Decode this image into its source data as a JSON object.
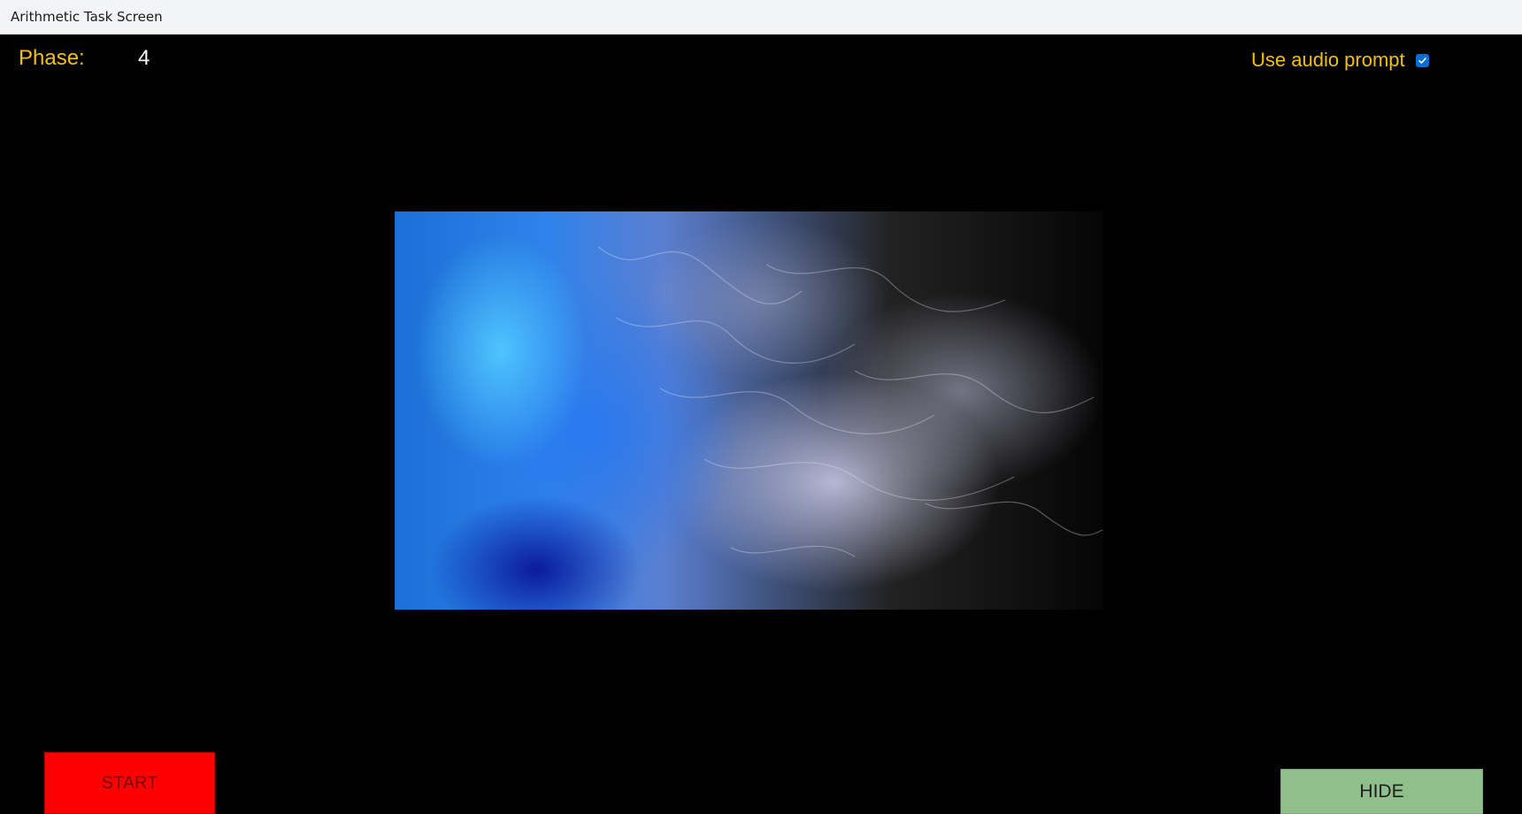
{
  "window": {
    "title": "Arithmetic Task Screen"
  },
  "phase": {
    "label": "Phase:",
    "value": "4"
  },
  "audio_prompt": {
    "label": "Use audio prompt",
    "checked": true
  },
  "media": {
    "description_icon": "smoke-image"
  },
  "buttons": {
    "start_label": "START",
    "hide_label": "HIDE"
  },
  "colors": {
    "label_accent": "#f2c200",
    "start_button": "#ff0000",
    "hide_button": "#8fbf8a",
    "checkbox": "#0a6ed1"
  }
}
